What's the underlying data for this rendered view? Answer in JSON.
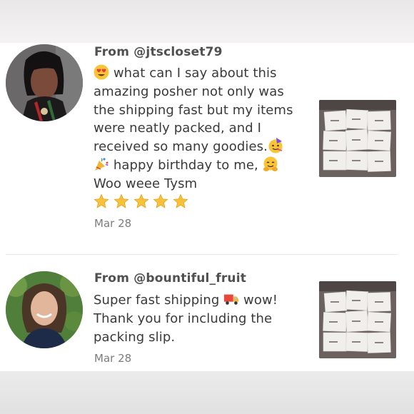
{
  "reviews": [
    {
      "from": "From @jtscloset79",
      "lines": [
        "what can I say about this",
        "amazing posher not only was",
        "the shipping fast but my items",
        "were neatly packed, and I",
        "received so many goodies.",
        "happy birthday to me,",
        "Woo weee Tysm"
      ],
      "rating": 5,
      "date": "Mar 28",
      "icons": [
        "heart-eyes-emoji",
        "party-face-emoji",
        "party-popper-emoji",
        "smiling-hug-emoji",
        "star-emoji"
      ]
    },
    {
      "from": "From @bountiful_fruit",
      "lines": [
        "Super fast shipping",
        "wow!",
        "Thank you for including the",
        "packing slip."
      ],
      "date": "Mar 28",
      "icons": [
        "delivery-truck-emoji"
      ]
    }
  ],
  "colors": {
    "panel": "#ffffff",
    "page_background": "#f1efef",
    "username": "#505050",
    "body_text": "#3a3a3a",
    "date": "#7c7c7c",
    "star": "#f7c23a"
  }
}
